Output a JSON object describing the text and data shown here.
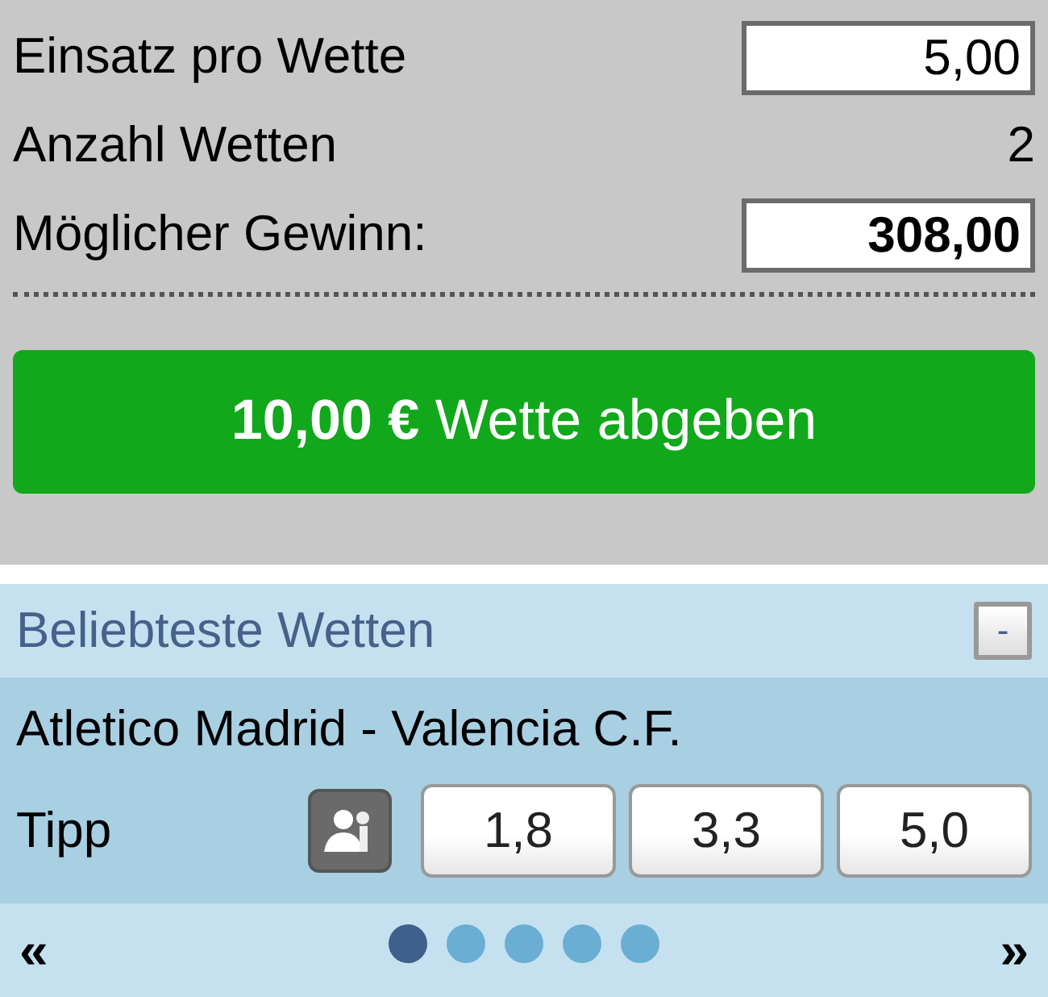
{
  "bet_slip": {
    "rows": [
      {
        "kind": "field",
        "label": "Einsatz pro Wette",
        "value": "5,00",
        "bold": false
      },
      {
        "kind": "text",
        "label": "Anzahl Wetten",
        "value": "2",
        "bold": false
      },
      {
        "kind": "field",
        "label": "Möglicher Gewinn:",
        "value": "308,00",
        "bold": true
      }
    ],
    "submit_button": "**10,00 €** Wette abgeben"
  },
  "popular_bets": {
    "title": "Beliebteste Wetten",
    "collapse_button": "-",
    "match": "Atletico Madrid - Valencia C.F.",
    "tip_label": "Tipp",
    "odds": [
      "1,8",
      "3,3",
      "5,0"
    ],
    "prev": "«",
    "next": "»",
    "pages": [
      {
        "selected": true
      },
      {
        "selected": false
      },
      {
        "selected": false
      },
      {
        "selected": false
      },
      {
        "selected": false
      }
    ]
  }
}
